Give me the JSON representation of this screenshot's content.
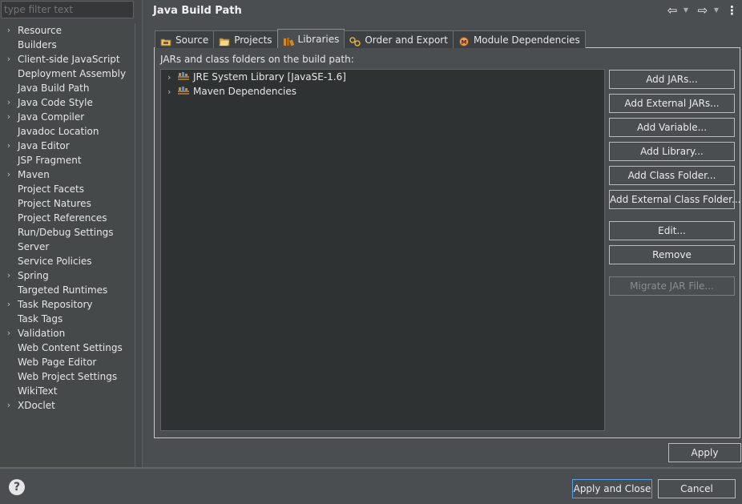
{
  "filter": {
    "placeholder": "type filter text"
  },
  "tree": {
    "items": [
      {
        "label": "Resource",
        "expandable": true
      },
      {
        "label": "Builders",
        "expandable": false
      },
      {
        "label": "Client-side JavaScript",
        "expandable": true
      },
      {
        "label": "Deployment Assembly",
        "expandable": false
      },
      {
        "label": "Java Build Path",
        "expandable": false
      },
      {
        "label": "Java Code Style",
        "expandable": true
      },
      {
        "label": "Java Compiler",
        "expandable": true
      },
      {
        "label": "Javadoc Location",
        "expandable": false
      },
      {
        "label": "Java Editor",
        "expandable": true
      },
      {
        "label": "JSP Fragment",
        "expandable": false
      },
      {
        "label": "Maven",
        "expandable": true
      },
      {
        "label": "Project Facets",
        "expandable": false
      },
      {
        "label": "Project Natures",
        "expandable": false
      },
      {
        "label": "Project References",
        "expandable": false
      },
      {
        "label": "Run/Debug Settings",
        "expandable": false
      },
      {
        "label": "Server",
        "expandable": false
      },
      {
        "label": "Service Policies",
        "expandable": false
      },
      {
        "label": "Spring",
        "expandable": true
      },
      {
        "label": "Targeted Runtimes",
        "expandable": false
      },
      {
        "label": "Task Repository",
        "expandable": true
      },
      {
        "label": "Task Tags",
        "expandable": false
      },
      {
        "label": "Validation",
        "expandable": true
      },
      {
        "label": "Web Content Settings",
        "expandable": false
      },
      {
        "label": "Web Page Editor",
        "expandable": false
      },
      {
        "label": "Web Project Settings",
        "expandable": false
      },
      {
        "label": "WikiText",
        "expandable": false
      },
      {
        "label": "XDoclet",
        "expandable": true
      }
    ]
  },
  "header": {
    "title": "Java Build Path"
  },
  "tabs": [
    {
      "label": "Source",
      "icon": "source-folder-icon"
    },
    {
      "label": "Projects",
      "icon": "projects-icon"
    },
    {
      "label": "Libraries",
      "icon": "libraries-icon",
      "active": true
    },
    {
      "label": "Order and Export",
      "icon": "order-export-icon"
    },
    {
      "label": "Module Dependencies",
      "icon": "module-dependencies-icon"
    }
  ],
  "libraries": {
    "caption": "JARs and class folders on the build path:",
    "entries": [
      {
        "label": "JRE System Library [JavaSE-1.6]",
        "icon": "library-icon"
      },
      {
        "label": "Maven Dependencies",
        "icon": "library-icon"
      }
    ]
  },
  "buttons": {
    "add_jars": "Add JARs...",
    "add_external_jars": "Add External JARs...",
    "add_variable": "Add Variable...",
    "add_library": "Add Library...",
    "add_class_folder": "Add Class Folder...",
    "add_external_class_folder": "Add External Class Folder...",
    "edit": "Edit...",
    "remove": "Remove",
    "migrate_jar": "Migrate JAR File...",
    "apply": "Apply",
    "apply_and_close": "Apply and Close",
    "cancel": "Cancel"
  },
  "colors": {
    "background": "#4a4e50",
    "tree_bg": "#2f3233",
    "focus_border": "#5aa0e6",
    "library_icon": "#d28b2c"
  }
}
